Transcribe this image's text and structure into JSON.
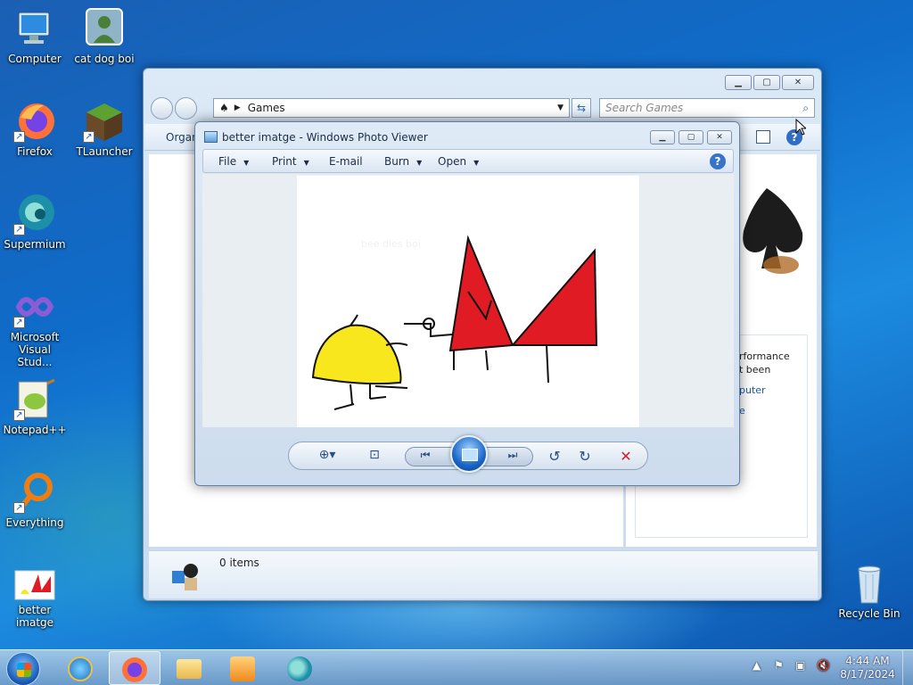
{
  "desktop": {
    "icons": [
      {
        "label": "Computer"
      },
      {
        "label": "cat dog boi"
      },
      {
        "label": "Firefox"
      },
      {
        "label": "TLauncher"
      },
      {
        "label": "Supermium"
      },
      {
        "label": "Microsoft Visual Stud..."
      },
      {
        "label": "Notepad++"
      },
      {
        "label": "Everything"
      },
      {
        "label": "better imatge"
      },
      {
        "label": "Recycle Bin"
      }
    ]
  },
  "explorer": {
    "address": "Games",
    "search_placeholder": "Search Games",
    "organize_label": "Organ",
    "panel_text_1": "rformance",
    "panel_text_2": "t been",
    "panel_link_1": "puter",
    "panel_link_2": "e",
    "status_items": "0 items"
  },
  "photo_viewer": {
    "title": "better imatge - Windows Photo Viewer",
    "menu": {
      "file": "File",
      "print": "Print",
      "email": "E-mail",
      "burn": "Burn",
      "open": "Open"
    },
    "help_glyph": "?",
    "image_faint_text": "bee dies boi"
  },
  "taskbar": {
    "apps": [
      "start",
      "internet-explorer",
      "firefox",
      "file-explorer",
      "media-player",
      "supermium"
    ],
    "time": "4:44 AM",
    "date": "8/17/2024"
  },
  "colors": {
    "drawing_red": "#e01b24",
    "drawing_yellow": "#f8e71c"
  }
}
